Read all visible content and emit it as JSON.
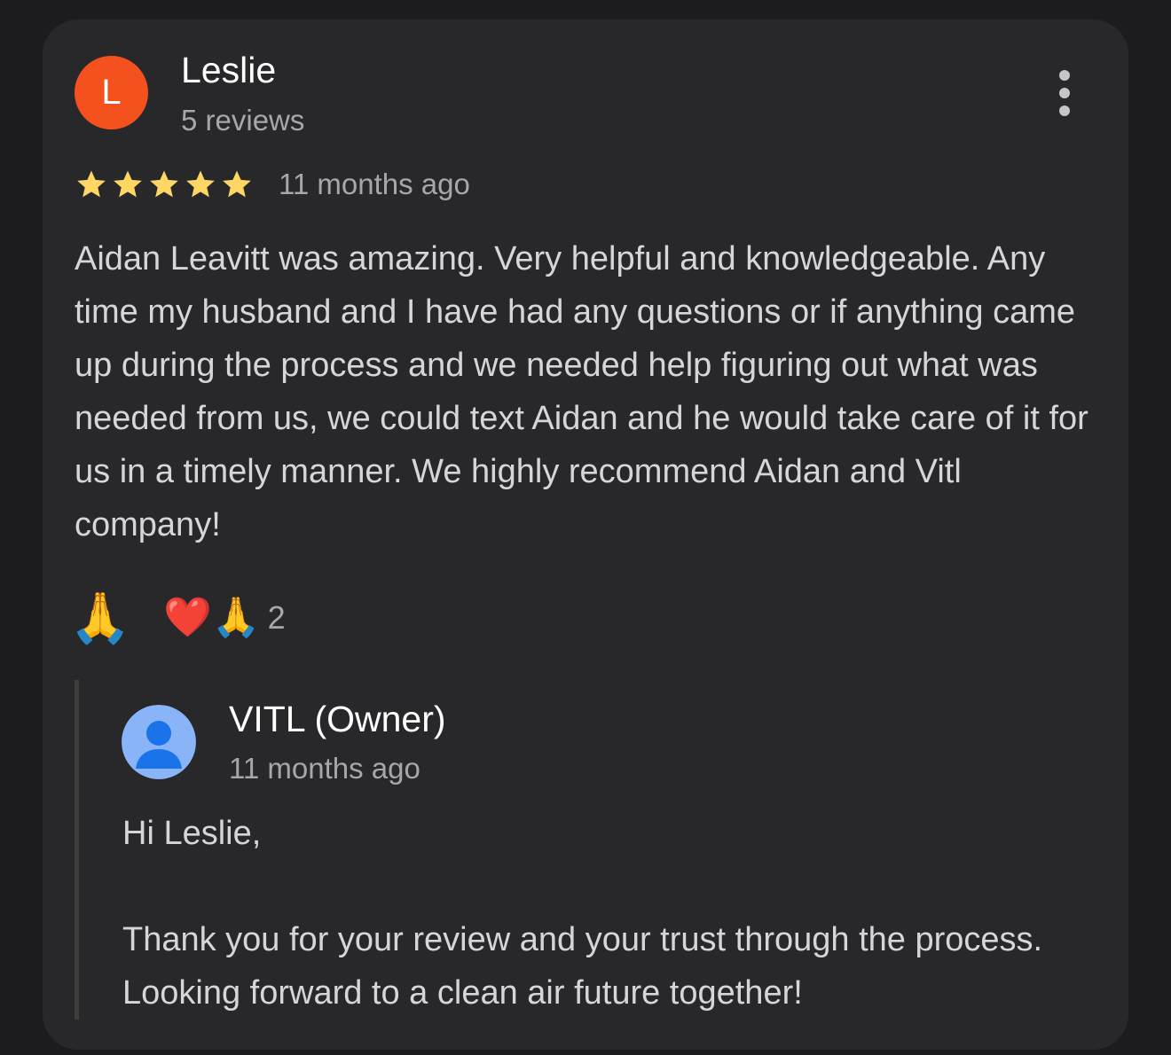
{
  "review": {
    "avatar_letter": "L",
    "avatar_color": "#f4511e",
    "reviewer_name": "Leslie",
    "review_count": "5 reviews",
    "rating": 5,
    "rating_max": 5,
    "star_color": "#fdd663",
    "date": "11 months ago",
    "text": "Aidan Leavitt was amazing. Very helpful and knowledgeable. Any time my husband and I have had any questions or if anything came up during the process and we needed help figuring out what was needed from us, we could text Aidan and he would take care of it for us in a timely manner. We highly recommend Aidan and Vitl company!",
    "more_icon": "more-vert-icon"
  },
  "reactions": {
    "single_emoji": "🙏",
    "group_emojis": "❤️🙏",
    "count": "2"
  },
  "owner_reply": {
    "avatar_icon": "person-icon",
    "avatar_color": "#8ab4f8",
    "name": "VITL (Owner)",
    "date": "11 months ago",
    "greeting": "Hi Leslie,",
    "text": "Thank you for your review and your trust through the process. Looking forward to a clean air future together!"
  }
}
